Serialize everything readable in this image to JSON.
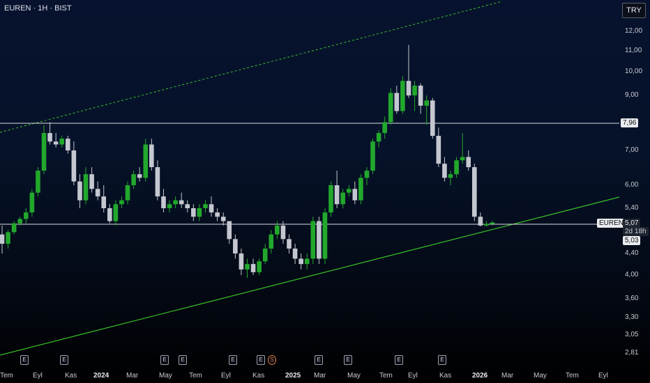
{
  "header": {
    "title": "EUREN · 1H · BIST",
    "currency": "TRY"
  },
  "price_axis": {
    "ticks": [
      "12,00",
      "11,00",
      "10,00",
      "9,00",
      "7,00",
      "6,00",
      "5,40",
      "4,40",
      "4,00",
      "3,60",
      "3,30",
      "3,05",
      "2,81"
    ]
  },
  "time_axis": {
    "ticks": [
      "Tem",
      "Eyl",
      "Kas",
      "2024",
      "Mar",
      "May",
      "Tem",
      "Eyl",
      "Kas",
      "2025",
      "Mar",
      "May",
      "Tem",
      "Eyl",
      "Kas",
      "2026",
      "Mar",
      "May",
      "Tem",
      "Eyl"
    ]
  },
  "levels": {
    "resistance": "7,96",
    "support": "5,03"
  },
  "last_price": {
    "symbol": "EUREN",
    "price": "5,07",
    "countdown": "2d 18h"
  },
  "events": [
    "E",
    "E",
    "E",
    "E",
    "E",
    "E",
    "S",
    "E",
    "E",
    "E",
    "E"
  ],
  "colors": {
    "up": "#22a82c",
    "down": "#c4c7cf",
    "trend": "#39c228",
    "level": "#d9dde4"
  },
  "chart_data": {
    "type": "candlestick",
    "symbol": "EUREN",
    "interval": "1H",
    "exchange": "BIST",
    "scale": "log",
    "ylim": [
      2.81,
      12.0
    ],
    "horizontal_levels": [
      7.96,
      5.03
    ],
    "series": [
      {
        "values": [
          [
            4.8,
            5.0,
            4.4,
            4.6
          ],
          [
            4.6,
            4.9,
            4.5,
            4.85
          ],
          [
            4.85,
            5.1,
            4.8,
            5.05
          ],
          [
            5.05,
            5.2,
            5.0,
            5.15
          ],
          [
            5.15,
            5.4,
            5.05,
            5.3
          ],
          [
            5.3,
            5.9,
            5.2,
            5.8
          ],
          [
            5.8,
            6.5,
            5.7,
            6.4
          ],
          [
            6.4,
            7.9,
            6.3,
            7.6
          ],
          [
            7.6,
            8.0,
            7.2,
            7.3
          ],
          [
            7.3,
            7.6,
            7.1,
            7.2
          ],
          [
            7.2,
            7.5,
            7.1,
            7.4
          ],
          [
            7.4,
            7.5,
            6.9,
            7.0
          ],
          [
            7.0,
            7.3,
            6.0,
            6.1
          ],
          [
            6.1,
            6.3,
            5.4,
            5.6
          ],
          [
            5.6,
            6.5,
            5.5,
            6.3
          ],
          [
            6.3,
            6.5,
            5.8,
            5.9
          ],
          [
            5.9,
            6.1,
            5.6,
            5.7
          ],
          [
            5.7,
            6.0,
            5.3,
            5.4
          ],
          [
            5.4,
            5.5,
            5.05,
            5.1
          ],
          [
            5.1,
            5.6,
            5.0,
            5.5
          ],
          [
            5.5,
            5.7,
            5.4,
            5.6
          ],
          [
            5.6,
            6.1,
            5.5,
            6.0
          ],
          [
            6.0,
            6.4,
            5.9,
            6.3
          ],
          [
            6.3,
            6.5,
            6.1,
            6.2
          ],
          [
            6.2,
            7.4,
            6.1,
            7.2
          ],
          [
            7.2,
            7.4,
            6.4,
            6.5
          ],
          [
            6.5,
            6.7,
            5.6,
            5.7
          ],
          [
            5.7,
            5.9,
            5.3,
            5.4
          ],
          [
            5.4,
            5.6,
            5.3,
            5.5
          ],
          [
            5.5,
            5.7,
            5.4,
            5.6
          ],
          [
            5.6,
            5.8,
            5.4,
            5.5
          ],
          [
            5.5,
            5.6,
            5.3,
            5.4
          ],
          [
            5.4,
            5.5,
            5.1,
            5.2
          ],
          [
            5.2,
            5.5,
            5.1,
            5.4
          ],
          [
            5.4,
            5.6,
            5.3,
            5.5
          ],
          [
            5.5,
            5.7,
            5.2,
            5.3
          ],
          [
            5.3,
            5.4,
            5.1,
            5.2
          ],
          [
            5.2,
            5.3,
            5.0,
            5.1
          ],
          [
            5.1,
            5.0,
            4.6,
            4.7
          ],
          [
            4.7,
            4.8,
            4.3,
            4.4
          ],
          [
            4.4,
            4.5,
            4.0,
            4.1
          ],
          [
            4.1,
            4.3,
            3.95,
            4.2
          ],
          [
            4.2,
            4.3,
            4.0,
            4.05
          ],
          [
            4.05,
            4.3,
            4.0,
            4.25
          ],
          [
            4.25,
            4.6,
            4.2,
            4.5
          ],
          [
            4.5,
            4.9,
            4.4,
            4.8
          ],
          [
            4.8,
            5.1,
            4.7,
            5.0
          ],
          [
            5.0,
            5.1,
            4.6,
            4.7
          ],
          [
            4.7,
            4.8,
            4.4,
            4.5
          ],
          [
            4.5,
            4.6,
            4.2,
            4.3
          ],
          [
            4.3,
            4.4,
            4.1,
            4.2
          ],
          [
            4.2,
            4.4,
            4.1,
            4.3
          ],
          [
            4.3,
            5.2,
            4.2,
            5.1
          ],
          [
            5.1,
            5.2,
            4.2,
            4.3
          ],
          [
            4.3,
            5.4,
            4.2,
            5.3
          ],
          [
            5.3,
            6.1,
            5.2,
            6.0
          ],
          [
            6.0,
            6.4,
            5.4,
            5.5
          ],
          [
            5.5,
            5.9,
            5.4,
            5.8
          ],
          [
            5.8,
            6.0,
            5.7,
            5.9
          ],
          [
            5.9,
            6.1,
            5.5,
            5.6
          ],
          [
            5.6,
            6.3,
            5.5,
            6.2
          ],
          [
            6.2,
            6.5,
            6.0,
            6.4
          ],
          [
            6.4,
            7.4,
            6.3,
            7.3
          ],
          [
            7.3,
            7.7,
            7.1,
            7.6
          ],
          [
            7.6,
            8.2,
            7.4,
            8.0
          ],
          [
            8.0,
            9.3,
            7.9,
            9.1
          ],
          [
            9.1,
            9.4,
            8.3,
            8.4
          ],
          [
            8.4,
            9.8,
            8.3,
            9.6
          ],
          [
            9.6,
            11.3,
            8.9,
            9.0
          ],
          [
            9.0,
            9.6,
            8.4,
            9.4
          ],
          [
            9.4,
            9.5,
            8.3,
            8.6
          ],
          [
            8.6,
            9.0,
            7.9,
            8.8
          ],
          [
            8.8,
            8.9,
            7.4,
            7.5
          ],
          [
            7.5,
            7.8,
            6.5,
            6.6
          ],
          [
            6.6,
            6.8,
            6.1,
            6.2
          ],
          [
            6.2,
            6.4,
            6.0,
            6.3
          ],
          [
            6.3,
            6.8,
            6.2,
            6.7
          ],
          [
            6.7,
            7.6,
            6.6,
            6.8
          ],
          [
            6.8,
            7.0,
            6.4,
            6.5
          ],
          [
            6.5,
            6.6,
            5.1,
            5.2
          ],
          [
            5.2,
            5.3,
            4.98,
            5.0
          ],
          [
            5.0,
            5.1,
            4.97,
            5.04
          ],
          [
            5.04,
            5.1,
            5.0,
            5.07
          ]
        ]
      }
    ]
  }
}
